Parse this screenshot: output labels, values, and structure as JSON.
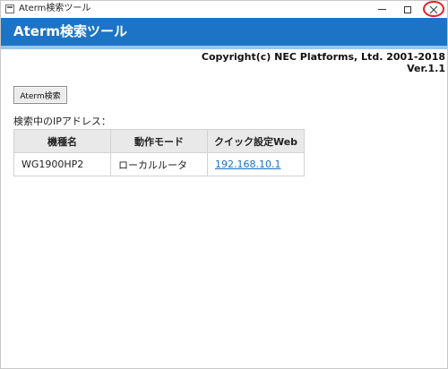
{
  "window": {
    "title": "Aterm検索ツール",
    "close_highlight_color": "#e52222"
  },
  "header": {
    "title": "Aterm検索ツール",
    "background": "#1d74c6"
  },
  "copyright": {
    "line1": "Copyright(c) NEC Platforms, Ltd. 2001-2018",
    "line2": "Ver.1.1"
  },
  "toolbar": {
    "search_label": "Aterm検索"
  },
  "results": {
    "label": "検索中のIPアドレス：",
    "columns": [
      "機種名",
      "動作モード",
      "クイック設定Web"
    ],
    "rows": [
      {
        "model": "WG1900HP2",
        "mode": "ローカルルータ",
        "link": "192.168.10.1"
      }
    ]
  }
}
